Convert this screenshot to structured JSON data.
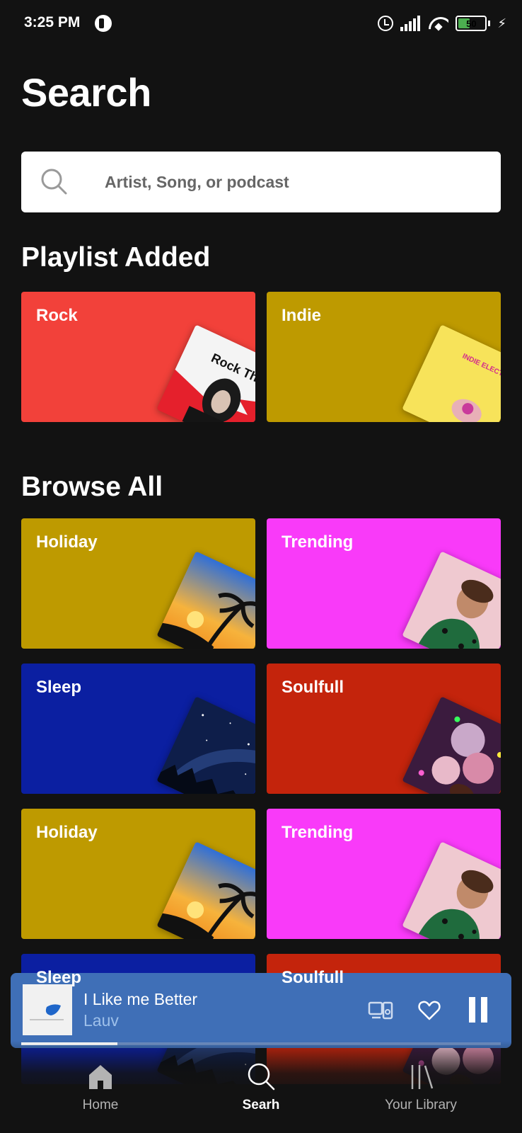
{
  "status_bar": {
    "time": "3:25 PM",
    "battery": "50"
  },
  "header": {
    "title": "Search"
  },
  "search": {
    "placeholder": "Artist, Song, or podcast"
  },
  "playlist_section": {
    "title": "Playlist Added",
    "cards": [
      {
        "label": "Rock",
        "color": "#f2413a",
        "art_text": "Rock Th"
      },
      {
        "label": "Indie",
        "color": "#be9a00",
        "art_text": "INDIE ELECTRONIC BEST OF NOW"
      }
    ]
  },
  "browse_section": {
    "title": "Browse All",
    "cards": [
      {
        "label": "Holiday",
        "color": "#be9a00"
      },
      {
        "label": "Trending",
        "color": "#f93af9"
      },
      {
        "label": "Sleep",
        "color": "#0b1fa1"
      },
      {
        "label": "Soulfull",
        "color": "#c4240c"
      },
      {
        "label": "Holiday",
        "color": "#be9a00"
      },
      {
        "label": "Trending",
        "color": "#f93af9"
      },
      {
        "label": "Sleep",
        "color": "#0b1fa1"
      },
      {
        "label": "Soulfull",
        "color": "#c4240c"
      }
    ]
  },
  "now_playing": {
    "title": "I Like me Better",
    "artist": "Lauv",
    "progress": 0.2,
    "color": "#3f6fb7"
  },
  "bottom_nav": {
    "items": [
      {
        "label": "Home",
        "icon": "home-icon"
      },
      {
        "label": "Searh",
        "icon": "search-icon",
        "active": true
      },
      {
        "label": "Your Library",
        "icon": "library-icon"
      }
    ]
  }
}
